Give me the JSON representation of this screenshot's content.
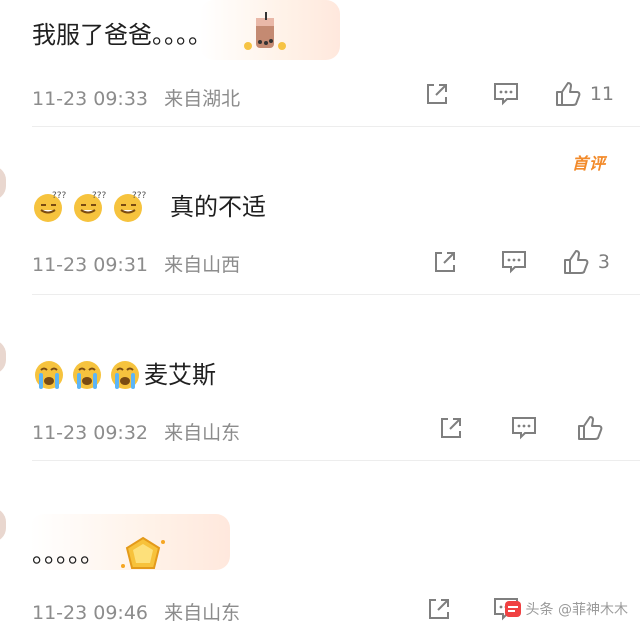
{
  "comments": [
    {
      "text": "我服了爸爸。。。。",
      "date": "11-23 09:33",
      "location": "来自湖北",
      "likes": "11"
    },
    {
      "badge": "首评",
      "text": "真的不适",
      "date": "11-23 09:31",
      "location": "来自山西",
      "likes": "3"
    },
    {
      "text": "麦艾斯",
      "date": "11-23 09:32",
      "location": "来自山东",
      "likes": ""
    },
    {
      "text": "。。。。。",
      "date": "11-23 09:46",
      "location": "来自山东",
      "likes": ""
    }
  ],
  "watermark": "头条 @菲神木木",
  "icons": {
    "share": "share-icon",
    "comment": "comment-icon",
    "like": "thumbs-up-icon",
    "sweat": "sweat-emoji-icon",
    "cry": "crying-emoji-icon",
    "cup": "bubble-tea-sticker-icon",
    "gem": "gold-gem-icon"
  },
  "colors": {
    "badge": "#f28a2a",
    "meta": "#8c8c8c",
    "icon": "#7f7f7f"
  }
}
